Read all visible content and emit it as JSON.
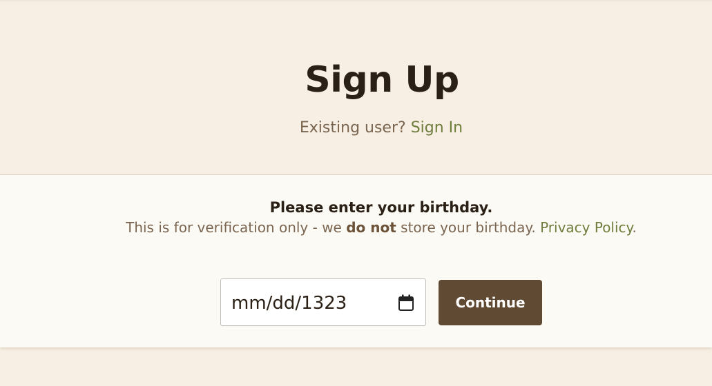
{
  "header": {
    "title": "Sign Up",
    "existing_user_text": "Existing user?",
    "sign_in_link": "Sign In"
  },
  "birthday": {
    "heading": "Please enter your birthday.",
    "note_prefix": "This is for verification only - we",
    "note_emphasis": "do not",
    "note_suffix": "store your birthday.",
    "privacy_link": "Privacy Policy",
    "privacy_period": "."
  },
  "form": {
    "date_value": "mm/dd/1323",
    "calendar_icon": "calendar-icon",
    "continue_label": "Continue"
  },
  "colors": {
    "page_background": "#f7efe3",
    "card_background": "#fcfaf5",
    "link": "#6f7d3c",
    "button": "#614a33",
    "text_dark": "#2a2016",
    "text_muted": "#7a6550"
  }
}
